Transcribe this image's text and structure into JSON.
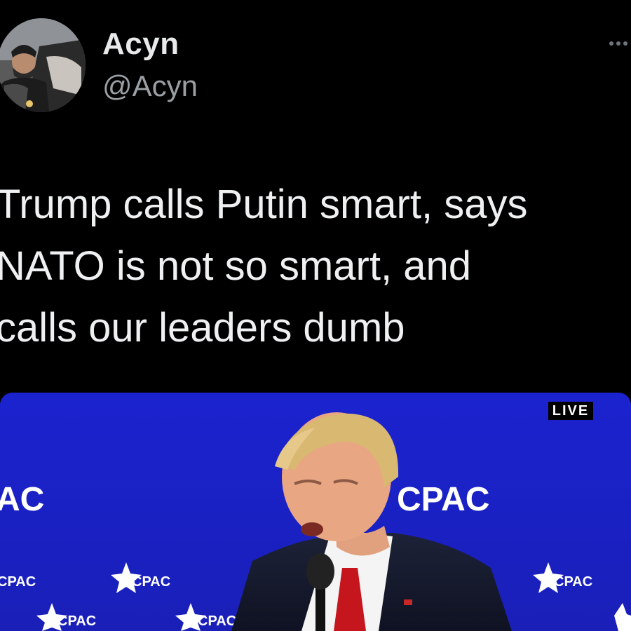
{
  "tweet": {
    "author": {
      "display_name": "Acyn",
      "handle": "@Acyn",
      "avatar_icon": "user-avatar"
    },
    "more_icon": "more-horizontal-icon",
    "text_lines": [
      "Trump calls Putin smart, says",
      "NATO is not so smart, and",
      "calls our leaders dumb"
    ],
    "media": {
      "badge": "LIVE",
      "stage_logos": [
        "AC",
        "CPAC"
      ],
      "background_text": "CPAC"
    }
  },
  "colors": {
    "background": "#000000",
    "text": "#e7e9ea",
    "secondary_text": "#9a9fa4",
    "stage_blue": "#1a22c8"
  }
}
